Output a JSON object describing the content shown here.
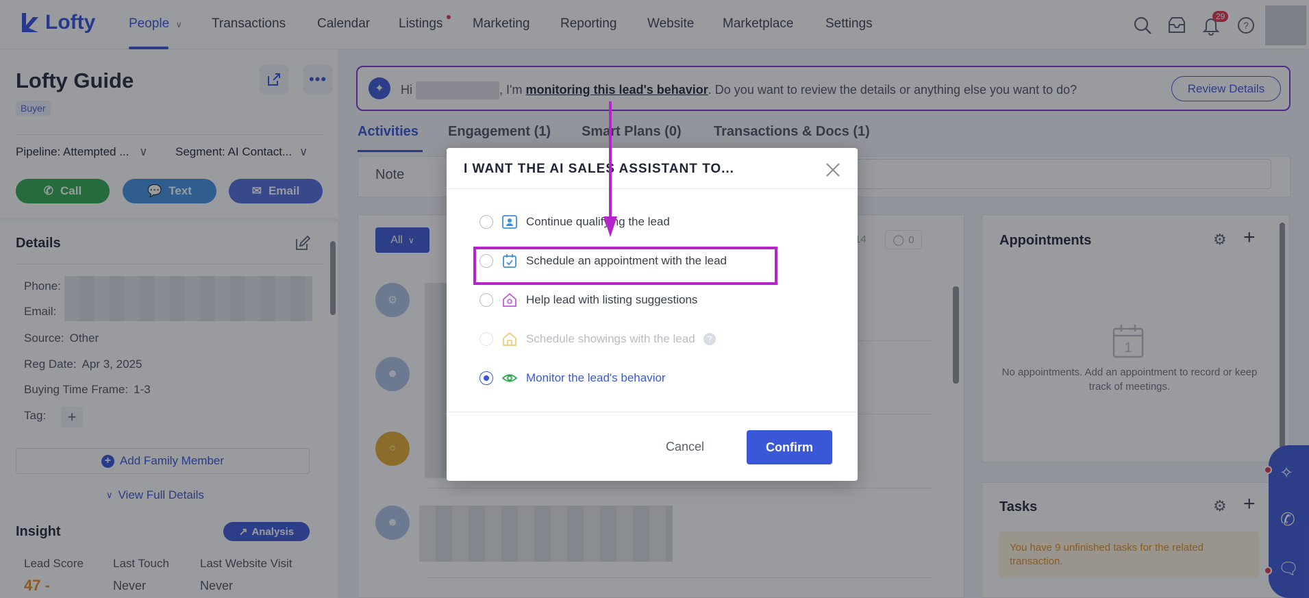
{
  "nav": {
    "logo": "Lofty",
    "items": [
      "People",
      "Transactions",
      "Calendar",
      "Listings",
      "Marketing",
      "Reporting",
      "Website",
      "Marketplace",
      "Settings"
    ],
    "notification_count": "29"
  },
  "lead": {
    "name": "Lofty Guide",
    "type": "Buyer",
    "pipeline": "Pipeline: Attempted ...",
    "segment": "Segment: AI Contact...",
    "call": "Call",
    "text": "Text",
    "email": "Email"
  },
  "details": {
    "title": "Details",
    "phone_label": "Phone:",
    "email_label": "Email:",
    "source_label": "Source:",
    "source": "Other",
    "reg_date_label": "Reg Date:",
    "reg_date": "Apr 3, 2025",
    "buying_label": "Buying Time Frame:",
    "buying": "1-3",
    "tag_label": "Tag:",
    "add_family": "Add Family Member",
    "view_full": "View Full Details"
  },
  "insight": {
    "title": "Insight",
    "analysis": "Analysis",
    "lead_score_label": "Lead Score",
    "lead_score": "47 -",
    "last_touch_label": "Last Touch",
    "last_touch": "Never",
    "last_visit_label": "Last Website Visit",
    "last_visit": "Never"
  },
  "ai_banner": {
    "hi": "Hi",
    "im": ", I'm",
    "link": "monitoring this lead's behavior",
    "rest": ". Do you want to review the details or anything else you want to do?",
    "button": "Review Details"
  },
  "tabs": [
    "Activities",
    "Engagement (1)",
    "Smart Plans (0)",
    "Transactions & Docs (1)"
  ],
  "note_label": "Note",
  "filter_all": "All",
  "filter_counts": [
    "14",
    "0"
  ],
  "appointments": {
    "title": "Appointments",
    "calendar_day": "1",
    "empty": "No appointments. Add an appointment to record or keep track of meetings."
  },
  "tasks": {
    "title": "Tasks",
    "warning": "You have 9 unfinished tasks for the related transaction."
  },
  "modal": {
    "title": "I WANT THE AI SALES ASSISTANT TO...",
    "options": [
      {
        "label": "Continue qualifying the lead",
        "state": "unchecked"
      },
      {
        "label": "Schedule an appointment with the lead",
        "state": "unchecked"
      },
      {
        "label": "Help lead with listing suggestions",
        "state": "unchecked"
      },
      {
        "label": "Schedule showings with the lead",
        "state": "disabled"
      },
      {
        "label": "Monitor the lead's behavior",
        "state": "checked"
      }
    ],
    "help": "?",
    "cancel": "Cancel",
    "confirm": "Confirm"
  },
  "colors": {
    "accent": "#3a57d8",
    "annotation": "#b525c9",
    "call": "#2aa84a",
    "text": "#3d8fe0",
    "email": "#4c6ad9"
  }
}
